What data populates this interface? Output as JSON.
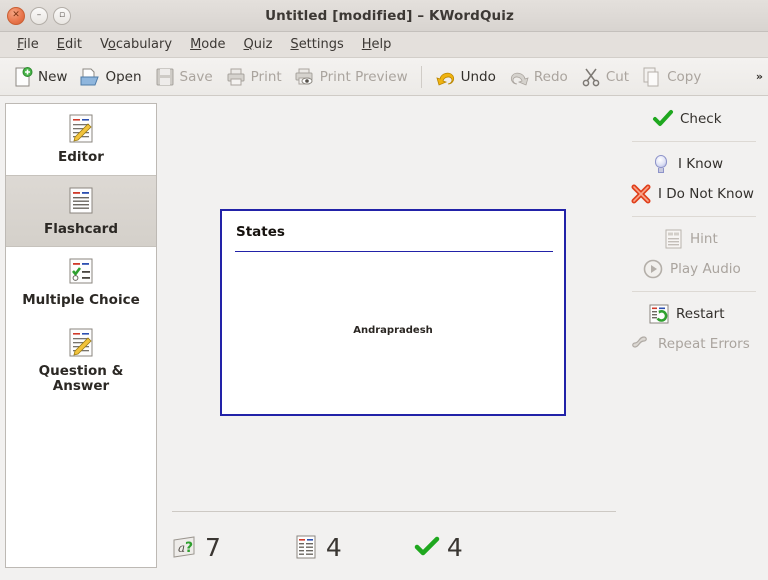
{
  "window": {
    "title": "Untitled [modified] – KWordQuiz",
    "controls": [
      {
        "name": "close",
        "glyph": "✕"
      },
      {
        "name": "minimize",
        "glyph": "–"
      },
      {
        "name": "maximize",
        "glyph": "▫"
      }
    ]
  },
  "menubar": {
    "items": [
      {
        "label": "File",
        "mnemonic": "F"
      },
      {
        "label": "Edit",
        "mnemonic": "E"
      },
      {
        "label": "Vocabulary",
        "mnemonic": "o"
      },
      {
        "label": "Mode",
        "mnemonic": "M"
      },
      {
        "label": "Quiz",
        "mnemonic": "Q"
      },
      {
        "label": "Settings",
        "mnemonic": "S"
      },
      {
        "label": "Help",
        "mnemonic": "H"
      }
    ]
  },
  "toolbar": {
    "overflow_glyph": "»",
    "items": [
      {
        "label": "New",
        "icon": "new-document-icon",
        "enabled": true
      },
      {
        "label": "Open",
        "icon": "open-folder-icon",
        "enabled": true
      },
      {
        "label": "Save",
        "icon": "floppy-disk-icon",
        "enabled": false
      },
      {
        "label": "Print",
        "icon": "printer-icon",
        "enabled": false
      },
      {
        "label": "Print Preview",
        "icon": "print-preview-icon",
        "enabled": false
      },
      {
        "label": "Undo",
        "icon": "undo-arrow-icon",
        "enabled": true
      },
      {
        "label": "Redo",
        "icon": "redo-arrow-icon",
        "enabled": false
      },
      {
        "label": "Cut",
        "icon": "scissors-icon",
        "enabled": false
      },
      {
        "label": "Copy",
        "icon": "copy-pages-icon",
        "enabled": false
      }
    ]
  },
  "sidebar": {
    "items": [
      {
        "label": "Editor",
        "icon": "editor-icon",
        "selected": false
      },
      {
        "label": "Flashcard",
        "icon": "flashcard-icon",
        "selected": true
      },
      {
        "label": "Multiple Choice",
        "icon": "multiple-choice-icon",
        "selected": false
      },
      {
        "label": "Question & Answer",
        "icon": "question-answer-icon",
        "selected": false
      }
    ]
  },
  "flashcard": {
    "title": "States",
    "answer": "Andrapradesh",
    "border_color": "#2222a8"
  },
  "actions": {
    "items": [
      {
        "label": "Check",
        "icon": "green-check-icon",
        "enabled": true
      },
      {
        "label": "I Know",
        "icon": "lightbulb-icon",
        "enabled": true
      },
      {
        "label": "I Do Not Know",
        "icon": "red-cross-icon",
        "enabled": true
      },
      {
        "label": "Hint",
        "icon": "hint-document-icon",
        "enabled": false
      },
      {
        "label": "Play Audio",
        "icon": "play-circle-icon",
        "enabled": false
      },
      {
        "label": "Restart",
        "icon": "restart-icon",
        "enabled": true
      },
      {
        "label": "Repeat Errors",
        "icon": "repeat-errors-icon",
        "enabled": false
      }
    ]
  },
  "statusbar": {
    "counters": [
      {
        "name": "question-count",
        "icon": "question-card-icon",
        "value": "7"
      },
      {
        "name": "vocabulary-count",
        "icon": "vocabulary-list-icon",
        "value": "4"
      },
      {
        "name": "correct-count",
        "icon": "green-check-icon",
        "value": "4"
      }
    ]
  }
}
